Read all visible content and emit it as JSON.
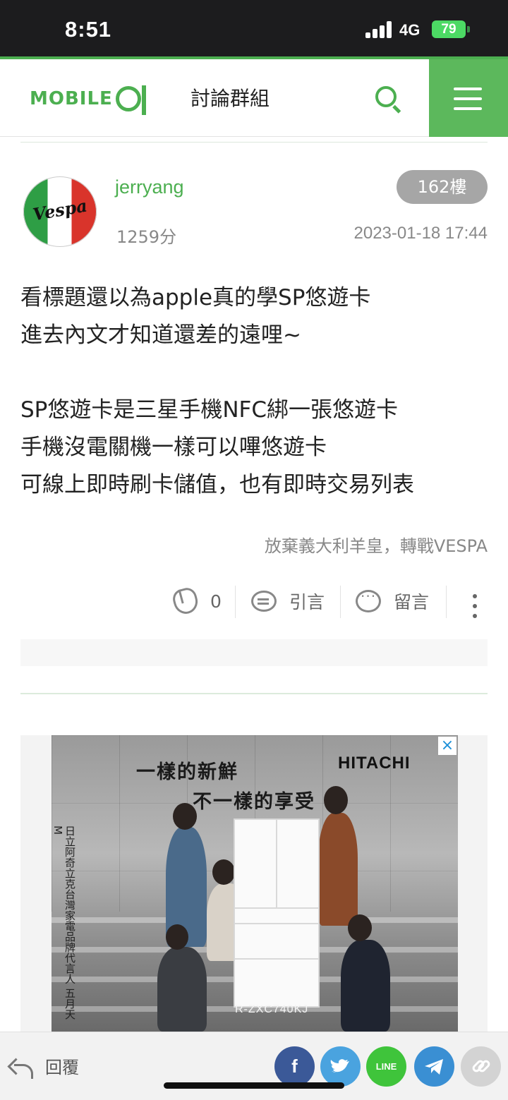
{
  "status_bar": {
    "time": "8:51",
    "network": "4G",
    "battery": "79"
  },
  "header": {
    "logo": "MOBILE01",
    "section_title": "討論群組"
  },
  "post": {
    "avatar_text": "Vespa",
    "username": "jerryang",
    "score": "1259分",
    "floor": "162樓",
    "date": "2023-01-18 17:44",
    "body_lines": [
      "看標題還以為apple真的學SP悠遊卡",
      "進去內文才知道還差的遠哩~",
      "",
      "SP悠遊卡是三星手機NFC綁一張悠遊卡",
      "手機沒電關機一樣可以嗶悠遊卡",
      "可線上即時刷卡儲值，也有即時交易列表"
    ],
    "signature": "放棄義大利羊皇，轉戰VESPA",
    "actions": {
      "like_count": "0",
      "quote_label": "引言",
      "comment_label": "留言"
    }
  },
  "ad": {
    "headline1": "一樣的新鮮",
    "headline2": "不一樣的享受",
    "brand": "HITACHI",
    "vertical_text": "日立阿奇立克台灣家電品牌代言人 五月天 M",
    "model": "R-ZXC740KJ",
    "close_icon": "×"
  },
  "bottom_bar": {
    "reply_label": "回覆",
    "share_colors": {
      "facebook": "#3b5998",
      "twitter": "#4aa3df",
      "line": "#3fc43b",
      "telegram": "#3a8fd3",
      "link": "#d3d3d3"
    },
    "facebook_glyph": "f",
    "line_glyph": "LINE"
  },
  "colors": {
    "brand_green": "#4caf50",
    "menu_green": "#5cb85c",
    "badge_gray": "#a6a6a6"
  }
}
